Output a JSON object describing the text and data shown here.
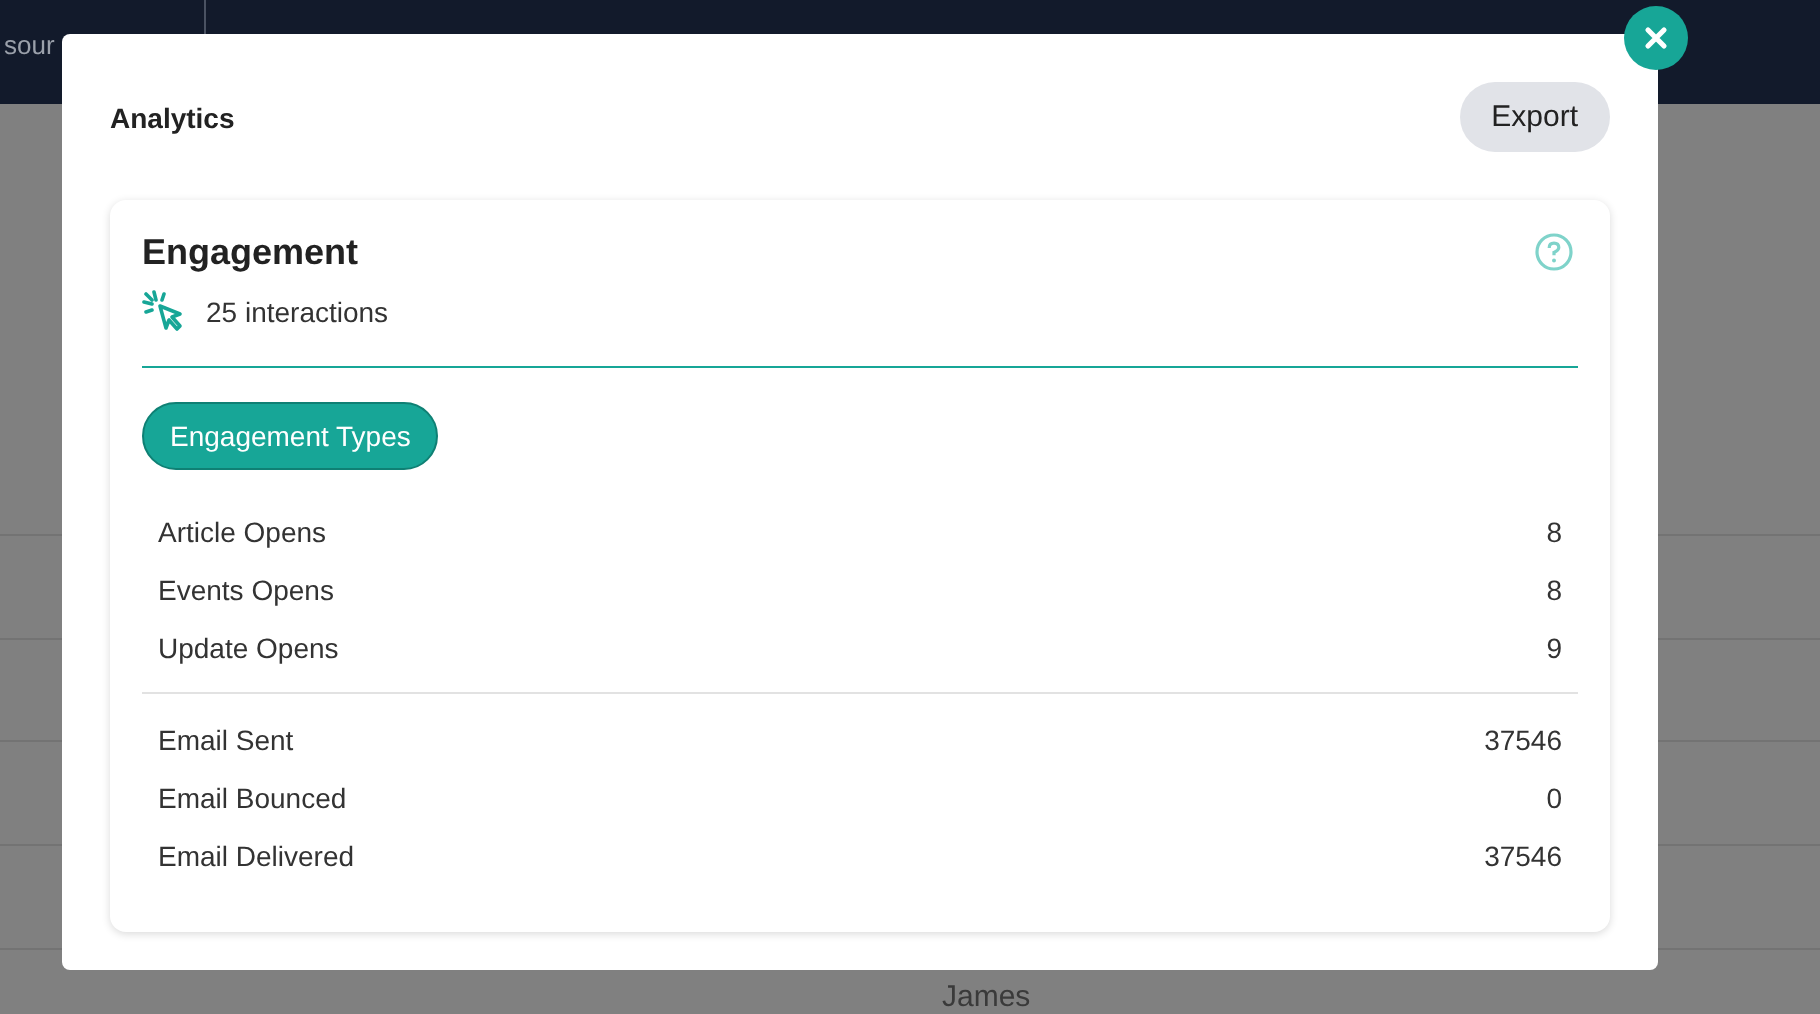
{
  "background": {
    "nav_text": "sour",
    "row_text": "James"
  },
  "modal": {
    "title": "Analytics",
    "export_button": "Export",
    "card": {
      "title": "Engagement",
      "interactions": "25 interactions",
      "pill": "Engagement Types",
      "groups": [
        [
          {
            "label": "Article Opens",
            "value": "8"
          },
          {
            "label": "Events Opens",
            "value": "8"
          },
          {
            "label": "Update Opens",
            "value": "9"
          }
        ],
        [
          {
            "label": "Email Sent",
            "value": "37546"
          },
          {
            "label": "Email Bounced",
            "value": "0"
          },
          {
            "label": "Email Delivered",
            "value": "37546"
          }
        ]
      ]
    }
  }
}
